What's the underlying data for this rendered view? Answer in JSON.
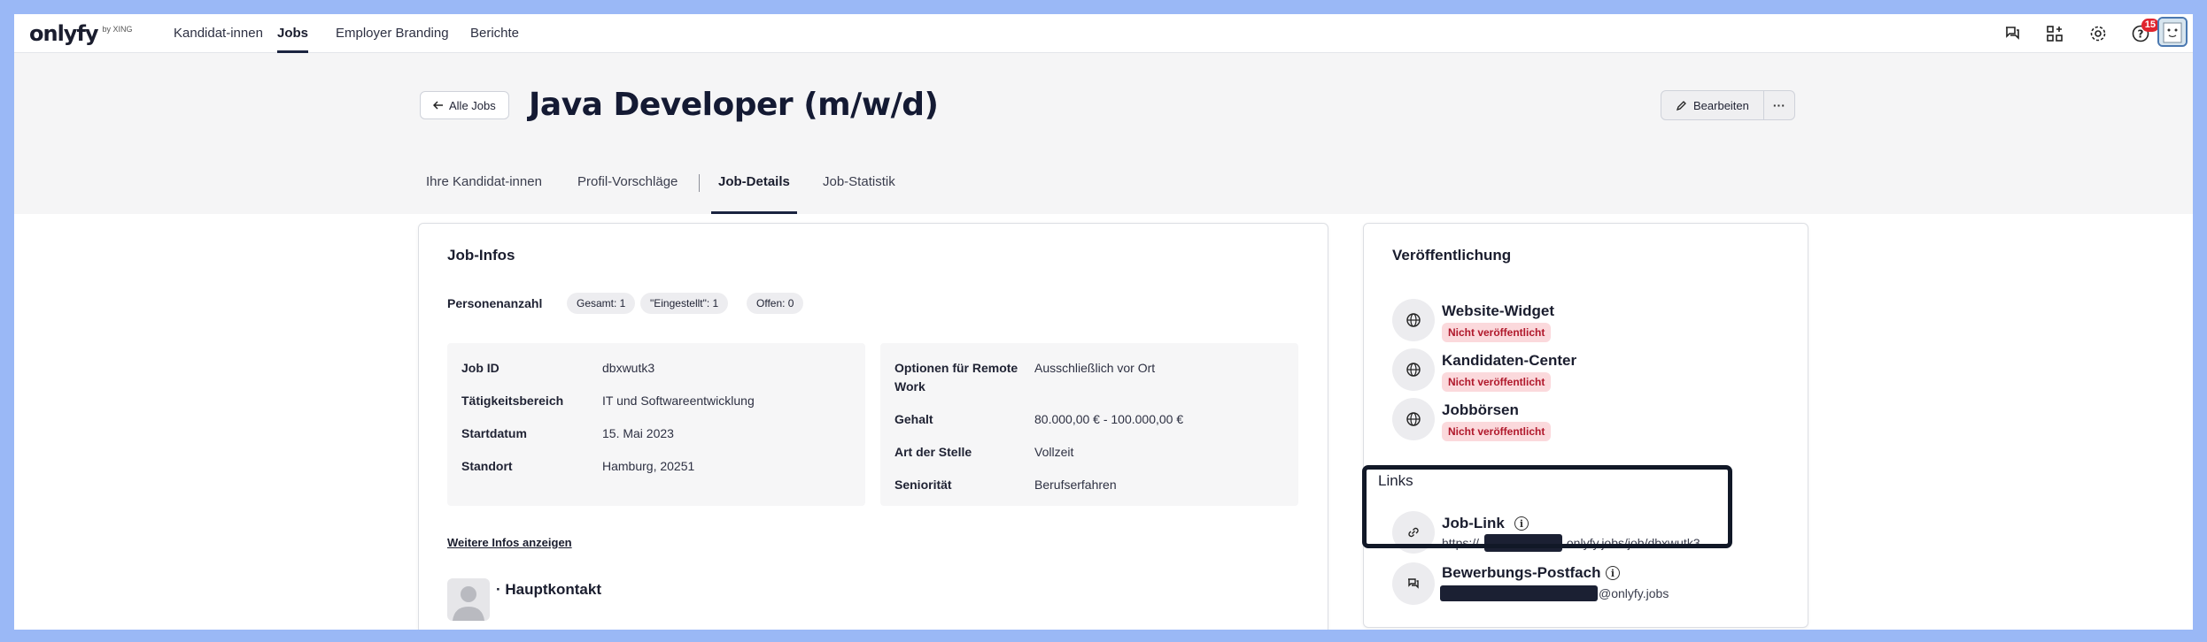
{
  "logo": {
    "word": "onlyfy",
    "by": "by XING"
  },
  "nav": {
    "items": [
      {
        "label": "Kandidat-innen"
      },
      {
        "label": "Jobs"
      },
      {
        "label": "Employer Branding"
      },
      {
        "label": "Berichte"
      }
    ],
    "active": "Jobs",
    "icons": [
      "chat-icon",
      "apps-icon",
      "gear-icon",
      "help-icon"
    ],
    "notification_count": "15"
  },
  "header": {
    "back_label": "Alle Jobs",
    "title": "Java Developer (m/w/d)",
    "edit_label": "Bearbeiten",
    "more_label": "···"
  },
  "tabs": [
    {
      "label": "Ihre Kandidat-innen"
    },
    {
      "label": "Profil-Vorschläge"
    },
    {
      "label": "Job-Details"
    },
    {
      "label": "Job-Statistik"
    }
  ],
  "active_tab": "Job-Details",
  "job_infos": {
    "title": "Job-Infos",
    "personen_label": "Personenanzahl",
    "chips": [
      "Gesamt: 1",
      "\"Eingestellt\": 1",
      "Offen: 0"
    ],
    "left": [
      {
        "label": "Job ID",
        "value": "dbxwutk3"
      },
      {
        "label": "Tätigkeitsbereich",
        "value": "IT und Softwareentwicklung"
      },
      {
        "label": "Startdatum",
        "value": "15. Mai 2023"
      },
      {
        "label": "Standort",
        "value": "Hamburg, 20251"
      }
    ],
    "right": [
      {
        "label": "Optionen für Remote Work",
        "value": "Ausschließlich vor Ort"
      },
      {
        "label": "Gehalt",
        "value": "80.000,00 € - 100.000,00 €"
      },
      {
        "label": "Art der Stelle",
        "value": "Vollzeit"
      },
      {
        "label": "Seniorität",
        "value": "Berufserfahren"
      }
    ],
    "more_link": "Weitere Infos anzeigen",
    "contact_title": "· Hauptkontakt"
  },
  "publication": {
    "title": "Veröffentlichung",
    "channels": [
      {
        "name": "Website-Widget",
        "status": "Nicht veröffentlicht"
      },
      {
        "name": "Kandidaten-Center",
        "status": "Nicht veröffentlicht"
      },
      {
        "name": "Jobbörsen",
        "status": "Nicht veröffentlicht"
      }
    ],
    "links_label": "Links",
    "job_link": {
      "name": "Job-Link",
      "prefix": "https://",
      "suffix": ".onlyfy.jobs/job/dbxwutk3"
    },
    "mailbox": {
      "name": "Bewerbungs-Postfach",
      "suffix": "@onlyfy.jobs"
    }
  },
  "colors": {
    "accent": "#1b2440",
    "status_bg": "#fbd9dc",
    "status_text": "#b0182b",
    "frame": "#9ab8f6"
  }
}
